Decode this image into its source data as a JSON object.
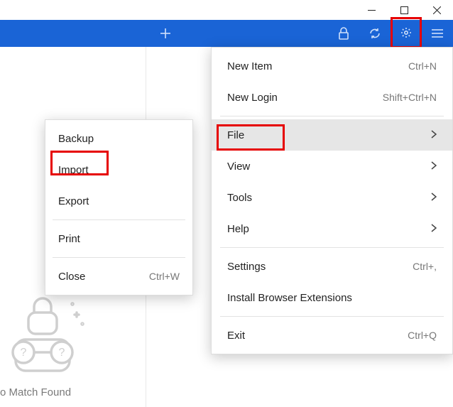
{
  "window_controls": {
    "minimize": "minimize",
    "maximize": "maximize",
    "close": "close"
  },
  "toolbar": {
    "plus": "add",
    "lock": "lock",
    "sync": "sync",
    "gear": "settings",
    "menu": "menu"
  },
  "main_menu": {
    "new_item": {
      "label": "New Item",
      "shortcut": "Ctrl+N"
    },
    "new_login": {
      "label": "New Login",
      "shortcut": "Shift+Ctrl+N"
    },
    "file": {
      "label": "File"
    },
    "view": {
      "label": "View"
    },
    "tools": {
      "label": "Tools"
    },
    "help": {
      "label": "Help"
    },
    "settings": {
      "label": "Settings",
      "shortcut": "Ctrl+,"
    },
    "extensions": {
      "label": "Install Browser Extensions"
    },
    "exit": {
      "label": "Exit",
      "shortcut": "Ctrl+Q"
    }
  },
  "file_submenu": {
    "backup": {
      "label": "Backup"
    },
    "import": {
      "label": "Import"
    },
    "export": {
      "label": "Export"
    },
    "print": {
      "label": "Print"
    },
    "close": {
      "label": "Close",
      "shortcut": "Ctrl+W"
    }
  },
  "empty_state": {
    "text": "o Match Found"
  }
}
